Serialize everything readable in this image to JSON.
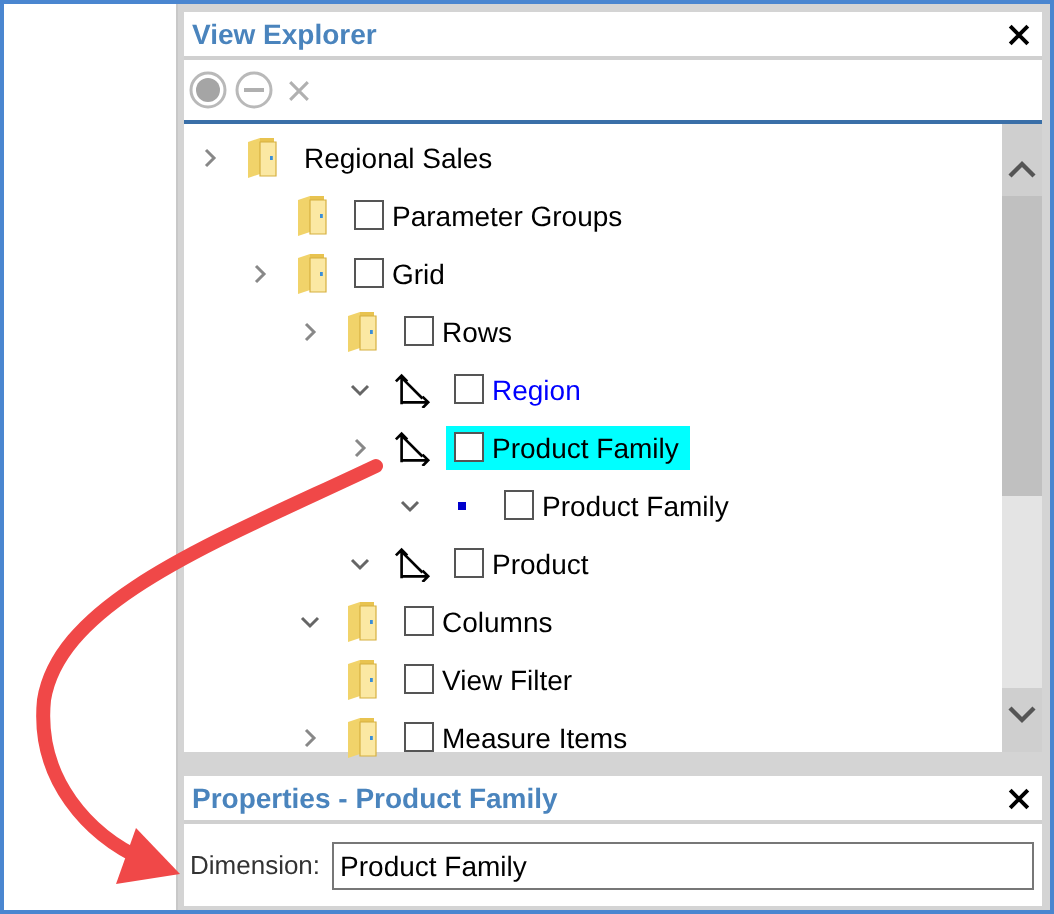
{
  "explorer": {
    "title": "View Explorer"
  },
  "tree": {
    "items": [
      {
        "label": "Regional Sales",
        "kind": "folder",
        "expanded": false,
        "selected": false,
        "color": "#000000",
        "children": [
          {
            "label": "Parameter Groups",
            "kind": "folder",
            "checked": false,
            "selected": false,
            "color": "#000000"
          },
          {
            "label": "Grid",
            "kind": "folder",
            "expanded": false,
            "checked": false,
            "selected": false,
            "color": "#000000",
            "children": [
              {
                "label": "Rows",
                "kind": "folder",
                "expanded": false,
                "checked": false,
                "selected": false,
                "color": "#000000",
                "children": [
                  {
                    "label": "Region",
                    "kind": "hierarchy",
                    "expanded": true,
                    "checked": false,
                    "selected": false,
                    "color": "#0000ff"
                  },
                  {
                    "label": "Product Family",
                    "kind": "hierarchy",
                    "expanded": false,
                    "checked": false,
                    "selected": true,
                    "color": "#000000",
                    "children": [
                      {
                        "label": "Product Family",
                        "kind": "level",
                        "expanded": true,
                        "checked": false,
                        "selected": false,
                        "color": "#000000"
                      }
                    ]
                  },
                  {
                    "label": "Product",
                    "kind": "hierarchy",
                    "expanded": true,
                    "checked": false,
                    "selected": false,
                    "color": "#000000"
                  }
                ]
              },
              {
                "label": "Columns",
                "kind": "folder",
                "expanded": true,
                "checked": false,
                "selected": false,
                "color": "#000000"
              },
              {
                "label": "View Filter",
                "kind": "folder",
                "checked": false,
                "selected": false,
                "color": "#000000"
              },
              {
                "label": "Measure Items",
                "kind": "folder",
                "expanded": false,
                "checked": false,
                "selected": false,
                "color": "#000000"
              }
            ]
          }
        ]
      }
    ]
  },
  "properties": {
    "title": "Properties - Product Family",
    "label": "Dimension:",
    "value": "Product Family"
  }
}
